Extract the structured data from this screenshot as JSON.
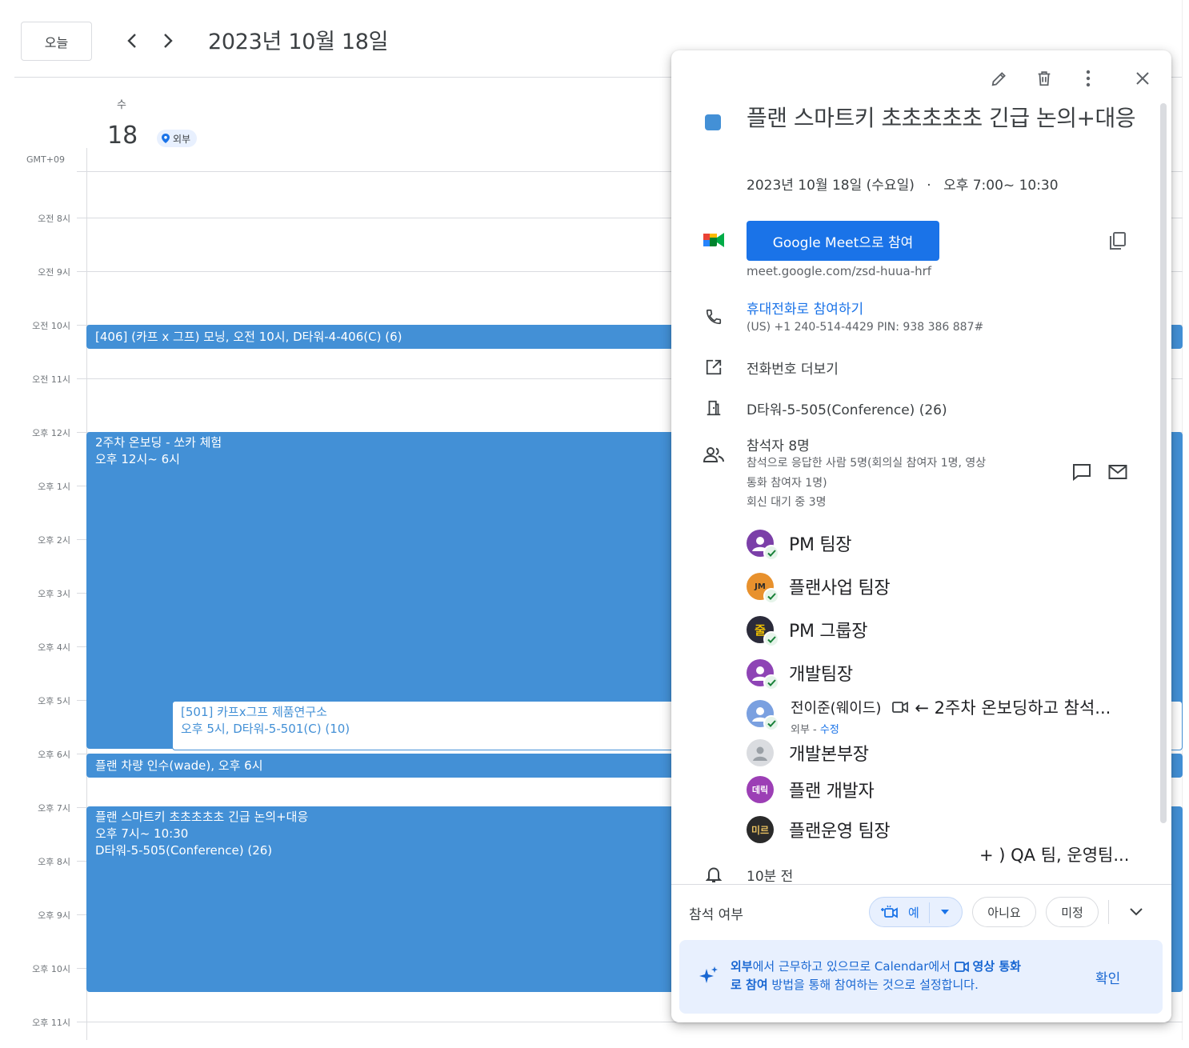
{
  "header": {
    "today_label": "오늘",
    "prev_icon": "chevron-left-icon",
    "next_icon": "chevron-right-icon",
    "date_title": "2023년 10월 18일"
  },
  "day": {
    "dow": "수",
    "num": "18",
    "location_chip": "외부",
    "timezone": "GMT+09"
  },
  "hours": [
    "오전 8시",
    "오전 9시",
    "오전 10시",
    "오전 11시",
    "오후 12시",
    "오후 1시",
    "오후 2시",
    "오후 3시",
    "오후 4시",
    "오후 5시",
    "오후 6시",
    "오후 7시",
    "오후 8시",
    "오후 9시",
    "오후 10시",
    "오후 11시"
  ],
  "events": {
    "e406": "[406] (카프 x 그프) 모닝, 오전 10시, D타워-4-406(C) (6)",
    "onboarding_title": "2주차 온보딩 - 쏘카 체험",
    "onboarding_time": "오후 12시~ 6시",
    "e501_title": "[501] 카프x그프 제품연구소",
    "e501_time": "오후 5시, D타워-5-501(C) (10)",
    "car": "플랜 차량 인수(wade), 오후 6시",
    "smartkey_title": "플랜 스마트키 초초초초초 긴급 논의+대응",
    "smartkey_time": "오후 7시~ 10:30",
    "smartkey_room": "D타워-5-505(Conference) (26)"
  },
  "popup": {
    "toolbar_icons": [
      "pencil-icon",
      "trash-icon",
      "more-vert-icon",
      "close-icon"
    ],
    "title": "플랜 스마트키 초초초초초 긴급 논의+대응",
    "when_date": "2023년 10월 18일 (수요일)",
    "when_sep": "·",
    "when_time": "오후 7:00~ 10:30",
    "meet_button": "Google Meet으로 참여",
    "meet_url": "meet.google.com/zsd-huua-hrf",
    "phone_join": "휴대전화로 참여하기",
    "phone_detail": "(US) +1 240-514-4429 PIN: 938 386 887#",
    "more_numbers": "전화번호 더보기",
    "room": "D타워-5-505(Conference) (26)",
    "guests_count": "참석자 8명",
    "guests_summary_1": "참석으로 응답한 사람 5명(회의실 참여자 1명, 영상",
    "guests_summary_2": "통화 참여자 1명)",
    "guests_pending": "회신 대기 중 3명",
    "attendees": [
      {
        "name": "PM 팀장"
      },
      {
        "name": "플랜사업 팀장",
        "initials": "JM"
      },
      {
        "name": "PM 그룹장",
        "initials": "줄"
      },
      {
        "name": "개발팀장"
      },
      {
        "name": "전이준(웨이드)",
        "note": "← 2주차 온보딩하고 참석...",
        "sub_prefix": "외부 - ",
        "sub_link": "수정"
      },
      {
        "name": "개발본부장"
      },
      {
        "name": "플랜 개발자",
        "initials": "데릭"
      },
      {
        "name": "플랜운영 팀장",
        "initials": "미르"
      }
    ],
    "more_attendees_note": "+ ) QA 팀, 운영팀...",
    "reminder": "10분 전",
    "rsvp_label": "참석 여부",
    "rsvp_yes": "예",
    "rsvp_no": "아니요",
    "rsvp_maybe": "미정",
    "banner_bold_1": "외부",
    "banner_text_1": "에서 근무하고 있으므로 Calendar에서",
    "banner_bold_2": "영상 통화",
    "banner_bold_3": "로 참여",
    "banner_text_2": " 방법을 통해 참여하는 것으로 설정합니다.",
    "banner_ok": "확인"
  },
  "colors": {
    "event_blue": "#4390d6",
    "link_blue": "#1a73e8",
    "avatar_purple": "#7b3fa8",
    "avatar_orange": "#e8912d",
    "avatar_dark": "#2b2b3a",
    "avatar_grey": "#dadce0"
  }
}
